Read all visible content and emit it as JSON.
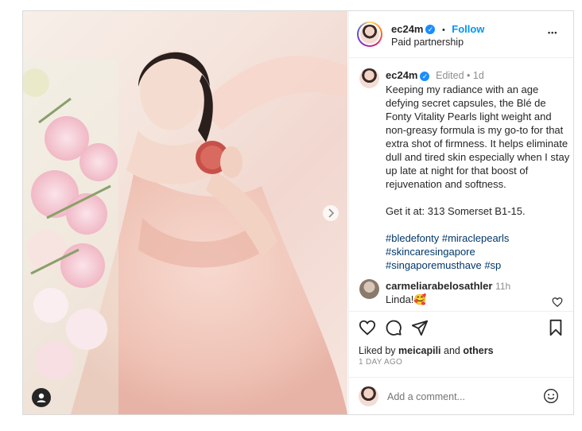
{
  "post": {
    "username": "ec24m",
    "follow_label": "Follow",
    "dot": "•",
    "subtitle": "Paid partnership",
    "more_label": "•••"
  },
  "caption": {
    "username": "ec24m",
    "meta": "Edited • 1d",
    "body": "Keeping my radiance with an age defying secret capsules, the Blé de Fonty Vitality Pearls light weight and non-greasy formula is my go-to for that extra shot of firmness. It helps eliminate dull and tired skin especially when I stay up late at night for that boost of rejuvenation and softness.",
    "location": "Get it at: 313 Somerset B1-15.",
    "hashtags": [
      "#bledefonty",
      "#miraclepearls",
      "#skincaresingapore",
      "#singaporemusthave",
      "#sp"
    ]
  },
  "comment": {
    "username": "carmeliarabelosathler",
    "time": "11h",
    "text": "Linda!🥰"
  },
  "likes": {
    "prefix": "Liked by ",
    "user": "meicapili",
    "middle": " and ",
    "others": "others"
  },
  "time_ago": "1 DAY AGO",
  "add_comment": {
    "placeholder": "Add a comment..."
  },
  "colors": {
    "link": "#0095f6",
    "hashtag": "#00376b",
    "muted": "#8e8e8e",
    "verified": "#1a8cff"
  }
}
